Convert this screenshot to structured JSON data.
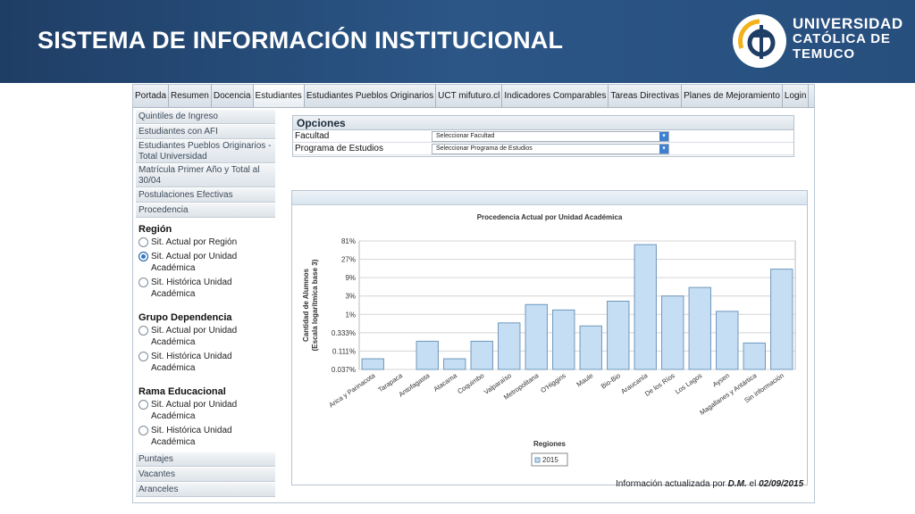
{
  "header": {
    "title": "SISTEMA DE INFORMACIÓN INSTITUCIONAL",
    "university": [
      "UNIVERSIDAD",
      "CATÓLICA DE",
      "TEMUCO"
    ],
    "logo_icon": "uct-logo-icon"
  },
  "nav": {
    "items": [
      "Portada",
      "Resumen",
      "Docencia",
      "Estudiantes",
      "Estudiantes Pueblos Originarios",
      "UCT mifuturo.cl",
      "Indicadores Comparables",
      "Tareas Directivas",
      "Planes de Mejoramiento",
      "Login"
    ],
    "active": "Estudiantes"
  },
  "sidebar": {
    "top_items": [
      "Quintiles de Ingreso",
      "Estudiantes con AFI",
      "Estudiantes Pueblos Originarios - Total Universidad",
      "Matrícula Primer Año y Total al 30/04",
      "Postulaciones Efectivas",
      "Procedencia"
    ],
    "groups": [
      {
        "heading": "Región",
        "options": [
          "Sit. Actual por Región",
          "Sit. Actual por Unidad Académica",
          "Sit. Histórica Unidad Académica"
        ],
        "selected": 1
      },
      {
        "heading": "Grupo Dependencia",
        "options": [
          "Sit. Actual por Unidad Académica",
          "Sit. Histórica Unidad Académica"
        ],
        "selected": -1
      },
      {
        "heading": "Rama Educacional",
        "options": [
          "Sit. Actual por Unidad Académica",
          "Sit. Histórica Unidad Académica"
        ],
        "selected": -1
      }
    ],
    "bottom_items": [
      "Puntajes",
      "Vacantes",
      "Aranceles"
    ]
  },
  "options": {
    "title": "Opciones",
    "rows": [
      {
        "label": "Facultad",
        "value": "Seleccionar Facultad"
      },
      {
        "label": "Programa de Estudios",
        "value": "Seleccionar Programa de Estudios"
      }
    ]
  },
  "footer": {
    "prefix": "Información actualizada por ",
    "author": "D.M.",
    "middle": " el ",
    "date": "02/09/2015"
  },
  "chart_data": {
    "type": "bar",
    "title": "Procedencia Actual por Unidad Académica",
    "xlabel": "Regiones",
    "ylabel_lines": [
      "Cantidad de Alumnos",
      "(Escala logarítmica base 3)"
    ],
    "y_scale": "log3",
    "y_ticks": [
      "0.037%",
      "0.111%",
      "0.333%",
      "1%",
      "3%",
      "9%",
      "27%",
      "81%"
    ],
    "y_tick_values": [
      0.037,
      0.111,
      0.333,
      1,
      3,
      9,
      27,
      81
    ],
    "categories": [
      "Arica y Parinacota",
      "Tarapaca",
      "Antofagasta",
      "Atacama",
      "Coquimbo",
      "Valparaíso",
      "Metropolitana",
      "O'Higgins",
      "Maule",
      "Bio-Bio",
      "Araucanía",
      "De los Ríos",
      "Los Lagos",
      "Aysen",
      "Magallanes y Antártica",
      "Sin información"
    ],
    "series": [
      {
        "name": "2015",
        "values": [
          0.07,
          null,
          0.2,
          0.07,
          0.2,
          0.6,
          1.8,
          1.3,
          0.5,
          2.2,
          65,
          3,
          5,
          1.2,
          0.18,
          15
        ]
      }
    ],
    "legend_position": "bottom",
    "grid": true,
    "bar_color": "#c5def3"
  }
}
